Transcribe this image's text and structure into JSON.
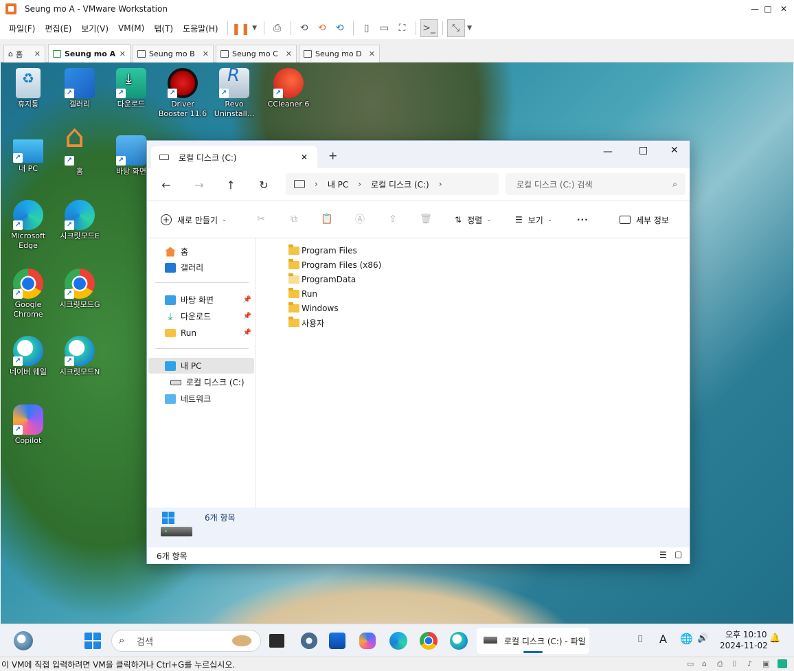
{
  "vmware": {
    "window_title": "Seung mo A - VMware Workstation",
    "menu": [
      "파일(F)",
      "편집(E)",
      "보기(V)",
      "VM(M)",
      "탭(T)",
      "도움말(H)"
    ],
    "tabs": [
      {
        "label": "홈"
      },
      {
        "label": "Seung mo A"
      },
      {
        "label": "Seung mo B"
      },
      {
        "label": "Seung mo C"
      },
      {
        "label": "Seung mo D"
      }
    ],
    "status_text": "이 VM에 직접 입력하려면 VM을 클릭하거나 Ctrl+G를 누르십시오.",
    "accent": "#e8742b"
  },
  "desktop": {
    "icons": [
      {
        "label": "휴지통",
        "icon": "recycle-bin-icon"
      },
      {
        "label": "갤러리",
        "icon": "gallery-icon"
      },
      {
        "label": "다운로드",
        "icon": "downloads-folder-icon"
      },
      {
        "label": "Driver Booster 11.6",
        "icon": "driver-booster-icon"
      },
      {
        "label": "Revo Uninstall...",
        "icon": "revo-uninstaller-icon"
      },
      {
        "label": "CCleaner 6",
        "icon": "ccleaner-icon"
      },
      {
        "label": "내 PC",
        "icon": "this-pc-icon"
      },
      {
        "label": "홈",
        "icon": "home-icon"
      },
      {
        "label": "바탕 화면",
        "icon": "desktop-folder-icon"
      },
      {
        "label": "Microsoft Edge",
        "icon": "edge-icon"
      },
      {
        "label": "시크릿모드E",
        "icon": "edge-icon"
      },
      {
        "label": "Google Chrome",
        "icon": "chrome-icon"
      },
      {
        "label": "시크릿모드G",
        "icon": "chrome-icon"
      },
      {
        "label": "네이버 웨일",
        "icon": "whale-icon"
      },
      {
        "label": "시크릿모드N",
        "icon": "whale-icon"
      },
      {
        "label": "Copilot",
        "icon": "copilot-icon"
      }
    ]
  },
  "explorer": {
    "tab_title": "로컬 디스크 (C:)",
    "breadcrumb": [
      "내 PC",
      "로컬 디스크 (C:)"
    ],
    "search_placeholder": "로컬 디스크 (C:) 검색",
    "commands": {
      "new": "새로 만들기",
      "sort": "정렬",
      "view": "보기",
      "details": "세부 정보"
    },
    "nav": {
      "home": "홈",
      "gallery": "갤러리",
      "desktop": "바탕 화면",
      "downloads": "다운로드",
      "run": "Run",
      "this_pc": "내 PC",
      "local_disk": "로컬 디스크 (C:)",
      "network": "네트워크"
    },
    "files": [
      {
        "name": "Program Files"
      },
      {
        "name": "Program Files (x86)"
      },
      {
        "name": "ProgramData"
      },
      {
        "name": "Run"
      },
      {
        "name": "Windows"
      },
      {
        "name": "사용자"
      }
    ],
    "details_count": "6개 항목",
    "status_count": "6개 항목"
  },
  "taskbar": {
    "search": "검색",
    "active_app": "로컬 디스크 (C:) - 파일",
    "tray_letter": "A",
    "time": "오후 10:10",
    "date": "2024-11-02"
  }
}
